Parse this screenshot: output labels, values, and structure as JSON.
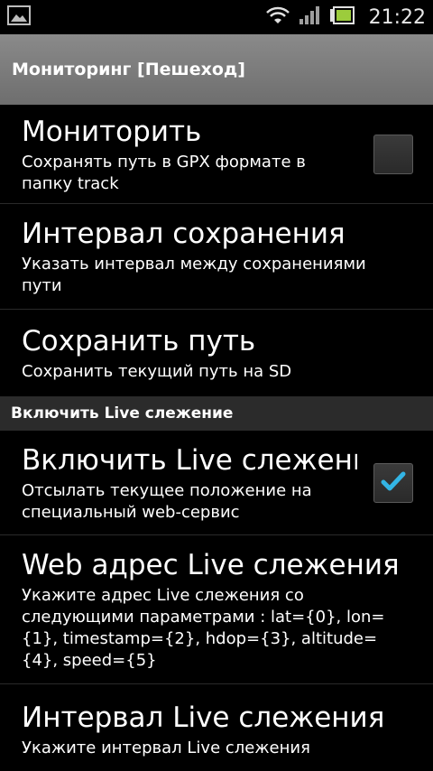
{
  "status_bar": {
    "time": "21:22",
    "icons": [
      "image-notification-icon",
      "wifi-icon",
      "signal-icon",
      "battery-icon"
    ]
  },
  "title_bar": {
    "title": "Мониторинг [Пешеход]"
  },
  "prefs": [
    {
      "title": "Мониторить",
      "summary": "Сохранять путь в GPX формате в папку track",
      "checkbox": true,
      "checked": false
    },
    {
      "title": "Интервал сохранения",
      "summary": "Указать интервал между сохранениями пути",
      "checkbox": false
    },
    {
      "title": "Сохранить путь",
      "summary": "Сохранить текущий путь на SD",
      "checkbox": false
    }
  ],
  "live_category": {
    "label": "Включить Live слежение"
  },
  "live_prefs": [
    {
      "title": "Включить Live слежение",
      "summary": "Отсылать текущее положение на специальный web-сервис",
      "checkbox": true,
      "checked": true
    },
    {
      "title": "Web адрес Live слежения",
      "summary": "Укажите адрес Live слежения со следующими параметрами : lat={0}, lon={1}, timestamp={2}, hdop={3}, altitude={4}, speed={5}",
      "checkbox": false
    },
    {
      "title": "Интервал Live слежения",
      "summary": "Укажите интервал Live слежения",
      "checkbox": false
    }
  ],
  "colors": {
    "background": "#000000",
    "title_bar": "#7a7a7a",
    "category_bar": "#2b2b2b",
    "check_accent": "#33b5e5"
  }
}
